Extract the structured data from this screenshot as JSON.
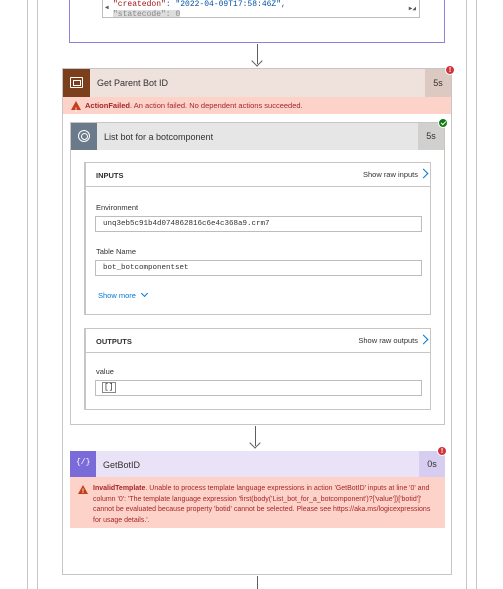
{
  "previous_action": {
    "code_line_1_key": "\"createdon\"",
    "code_line_1_value": ": \"2022-04-09T17:58:46Z\",",
    "code_line_2": "\"statecode\": 0"
  },
  "get_parent_bot_id": {
    "title": "Get Parent Bot ID",
    "duration": "5s",
    "error_badge": "!",
    "error_label": "ActionFailed",
    "error_message": ". An action failed. No dependent actions succeeded."
  },
  "list_bot": {
    "title": "List bot for a botcomponent",
    "duration": "5s",
    "inputs": {
      "header": "INPUTS",
      "show_raw": "Show raw inputs",
      "environment_label": "Environment",
      "environment_value": "unq3eb5c91b4d074862816c6e4c368a9.crm7",
      "table_label": "Table Name",
      "table_value": "bot_botcomponentset",
      "show_more": "Show more"
    },
    "outputs": {
      "header": "OUTPUTS",
      "show_raw": "Show raw outputs",
      "value_label": "value",
      "value_value": "[]"
    }
  },
  "get_bot_id": {
    "title": "GetBotID",
    "duration": "0s",
    "error_badge": "!",
    "error_label": "InvalidTemplate",
    "error_message": ". Unable to process template language expressions in action 'GetBotID' inputs at line '0' and column '0': 'The template language expression 'first(body('List_bot_for_a_botcomponent')?['value'])['botid']' cannot be evaluated because property 'botid' cannot be selected. Please see https://aka.ms/logicexpressions for usage details.'."
  },
  "icons": {
    "scope": "scope-icon",
    "dataverse": "dataverse-icon",
    "expression": "expression-icon",
    "warning": "warning-icon"
  },
  "colors": {
    "error": "#d13438",
    "success": "#107c10",
    "link": "#0078d4",
    "scope_brown": "#7b3f1c",
    "expression_purple": "#7b6bd9"
  }
}
